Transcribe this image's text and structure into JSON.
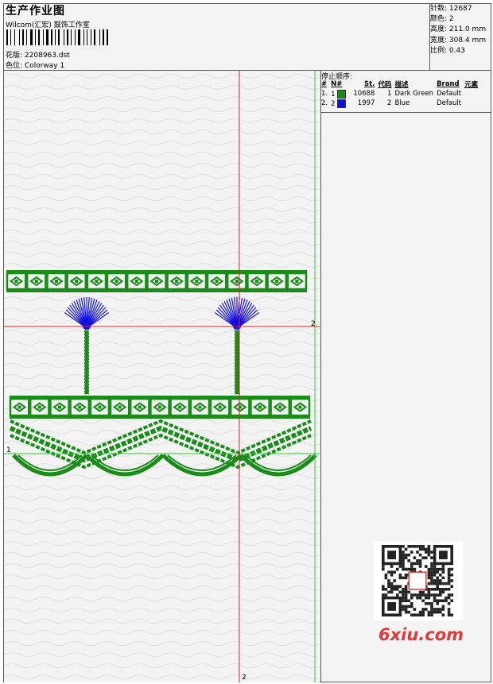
{
  "header": {
    "title": "生产作业图",
    "company": "Wilcom(汇宏) 鼓饰工作室",
    "design_label": "花版:",
    "design_file": "2208963.dst",
    "color_label": "色位:",
    "colorway": "Colorway 1"
  },
  "stats": [
    {
      "label": "针数:",
      "value": "12687"
    },
    {
      "label": "颜色:",
      "value": "2"
    },
    {
      "label": "高度:",
      "value": "211.0 mm"
    },
    {
      "label": "宽度:",
      "value": "308.4 mm"
    },
    {
      "label": "比例:",
      "value": "0.43"
    }
  ],
  "stop_sequence": {
    "title": "停止顺序:",
    "headers": [
      "#",
      "N#",
      "St.",
      "代码",
      "描述",
      "Brand",
      "元素"
    ],
    "rows": [
      {
        "idx": "1.",
        "n": "1",
        "color": "#1a8c1a",
        "st": "10688",
        "code": "1",
        "desc": "Dark Green",
        "brand": "Default"
      },
      {
        "idx": "2.",
        "n": "2",
        "color": "#1010e0",
        "st": "1997",
        "code": "2",
        "desc": "Blue",
        "brand": "Default"
      }
    ]
  },
  "guides": {
    "h_red_label": "2",
    "h_green_label": "1",
    "v_red_label": "2"
  },
  "watermark": "6xiu.com",
  "colors": {
    "green": "#1a8c1a",
    "blue": "#1010e0",
    "red_guide": "#e02020",
    "green_guide": "#33cc33"
  }
}
